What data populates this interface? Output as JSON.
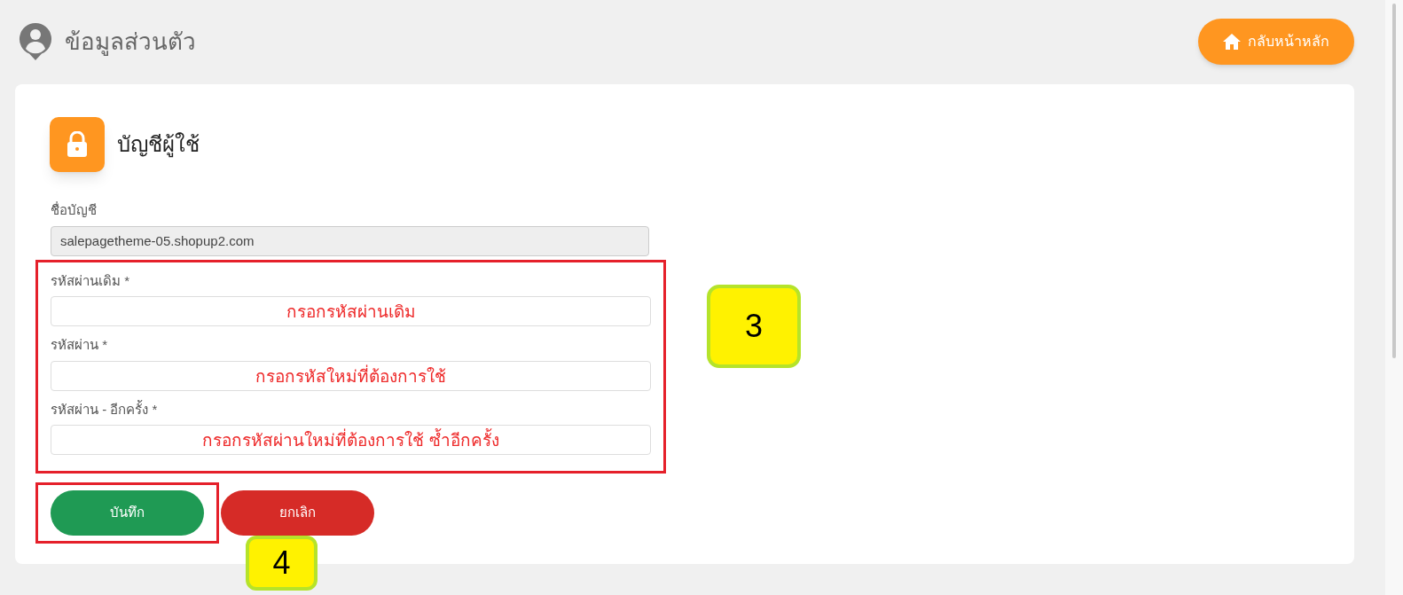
{
  "header": {
    "title": "ข้อมูลส่วนตัว",
    "home_button": "กลับหน้าหลัก"
  },
  "section": {
    "title": "บัญชีผู้ใช้"
  },
  "account": {
    "label": "ชื่อบัญชี",
    "value": "salepagetheme-05.shopup2.com",
    "disabled": true
  },
  "password_fields": [
    {
      "label": "รหัสผ่านเดิม *",
      "value": "กรอกรหัสผ่านเดิม"
    },
    {
      "label": "รหัสผ่าน *",
      "value": "กรอกรหัสใหม่ที่ต้องการใช้"
    },
    {
      "label": "รหัสผ่าน - อีกครั้ง *",
      "value": "กรอกรหัสผ่านใหม่ที่ต้องการใช้ ซ้ำอีกครั้ง"
    }
  ],
  "buttons": [
    {
      "label": "บันทึก",
      "kind": "save"
    },
    {
      "label": "ยกเลิก",
      "kind": "cancel"
    }
  ],
  "step_badges": [
    {
      "label": "3"
    },
    {
      "label": "4"
    }
  ]
}
